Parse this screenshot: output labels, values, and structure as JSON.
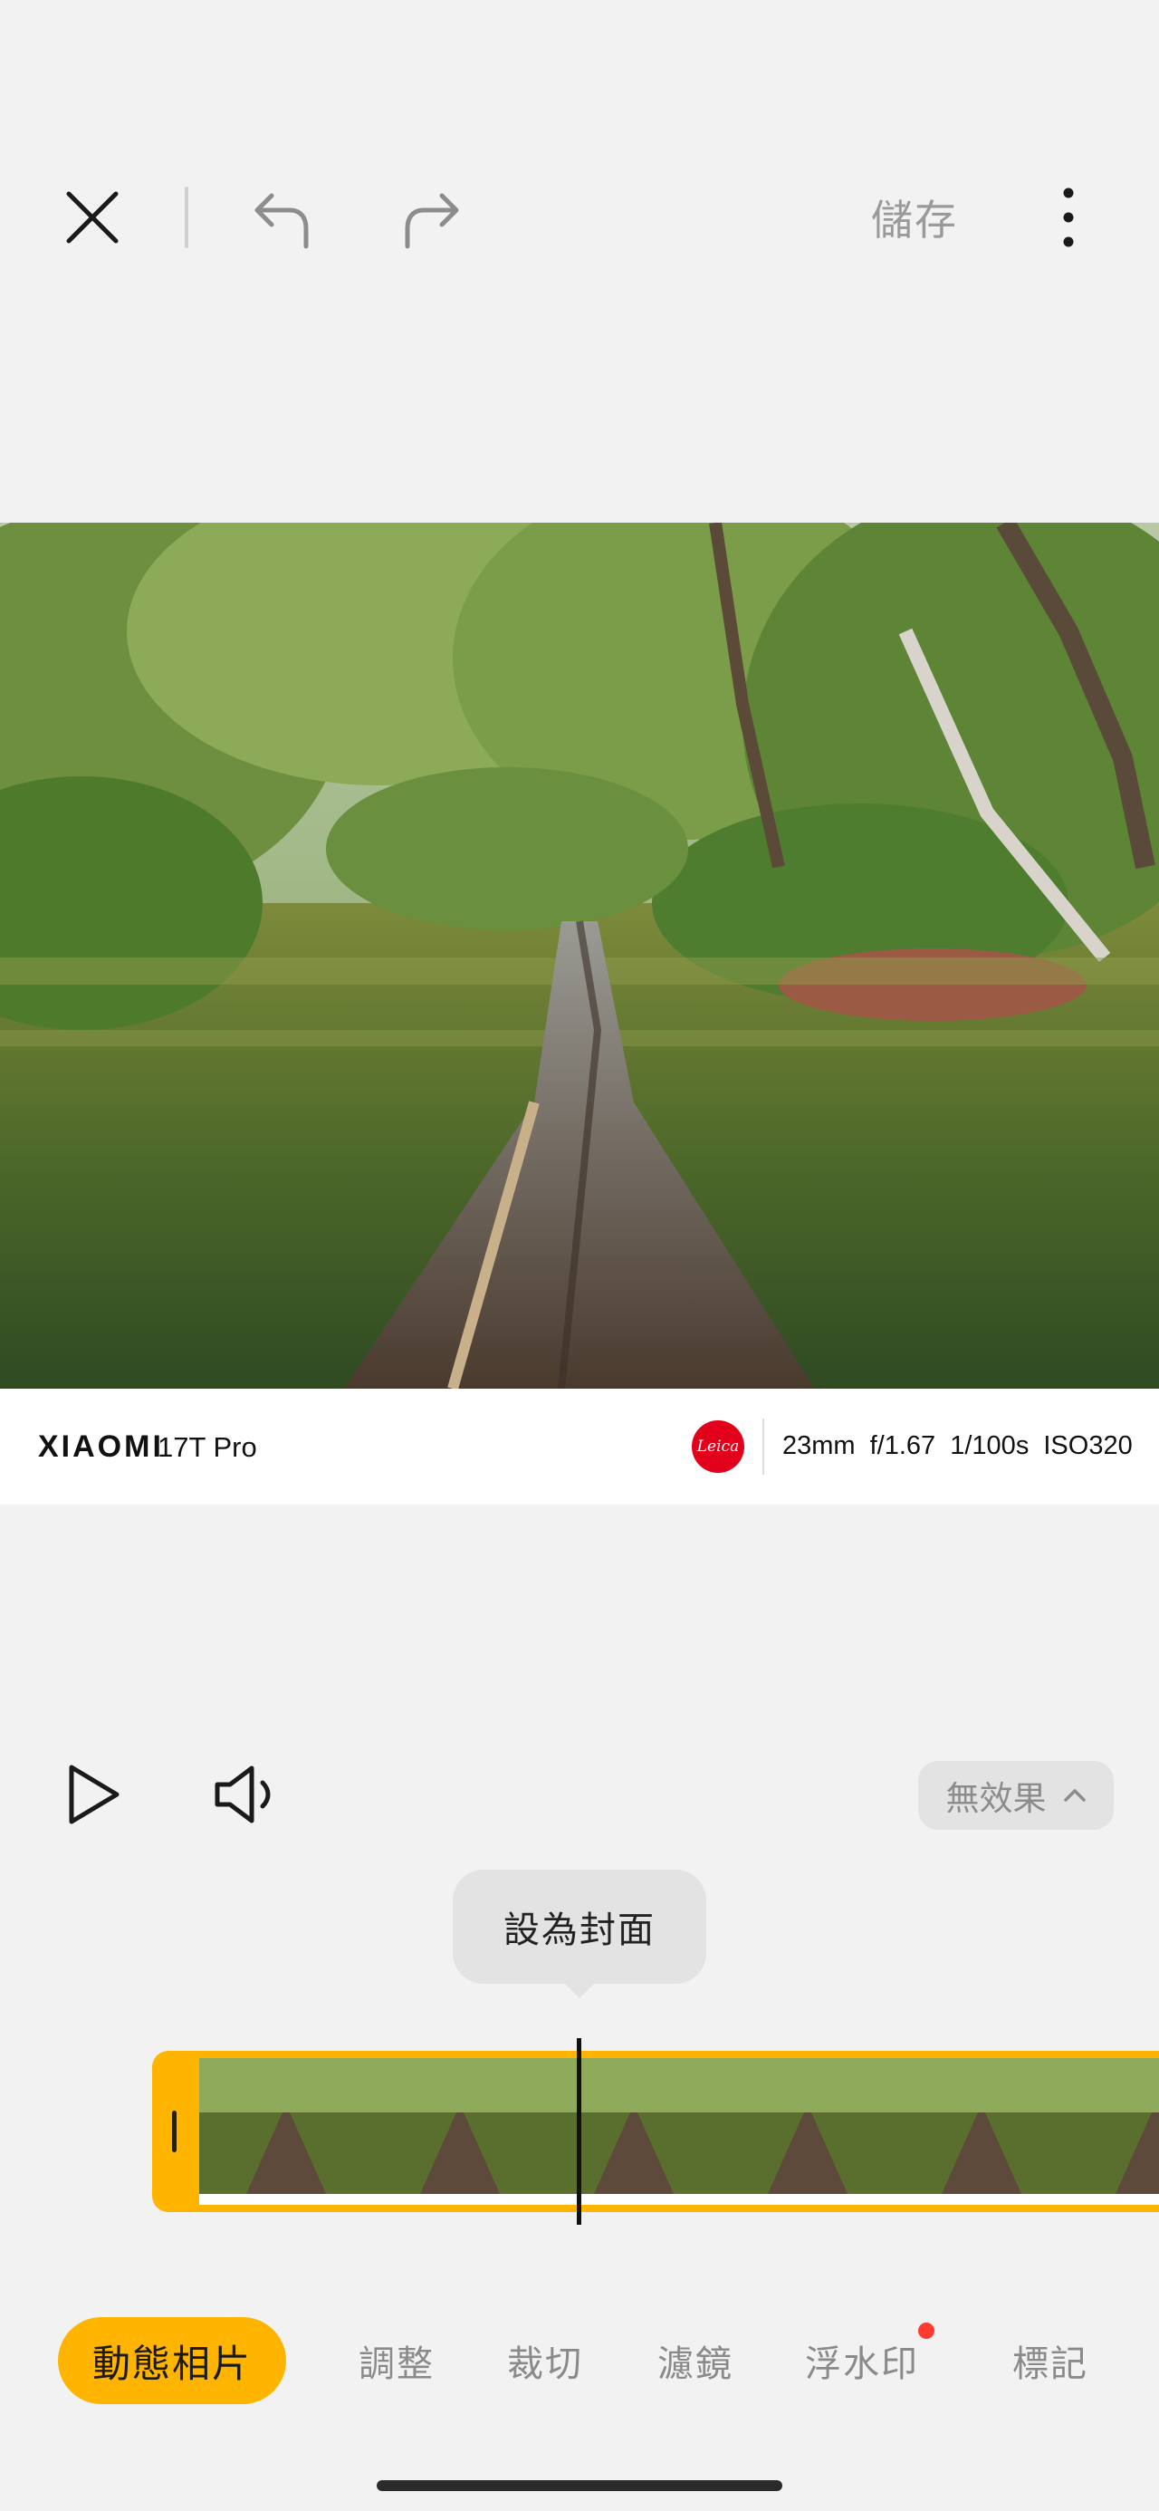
{
  "toolbar": {
    "save_label": "儲存",
    "icons": [
      "close-icon",
      "undo-icon",
      "redo-icon",
      "more-vertical-icon"
    ]
  },
  "watermark": {
    "brand": "XIAOMI",
    "model": "17T Pro",
    "lens_brand_logo": "Leica",
    "params": "23mm  f/1.67  1/100s  ISO320",
    "logo_color": "#e2001a"
  },
  "playback": {
    "icons": [
      "play-icon",
      "volume-icon",
      "chevron-up-icon"
    ],
    "effect_label": "無效果"
  },
  "cover": {
    "tooltip": "設為封面"
  },
  "timeline": {
    "frame_count": 6,
    "accent": "#ffb400"
  },
  "tabs": {
    "live_photo": "動態相片",
    "adjust": "調整",
    "crop": "裁切",
    "filter": "濾鏡",
    "watermark": "浮水印",
    "markup": "標記"
  },
  "colors": {
    "accent": "#ffb400",
    "background": "#f2f2f2",
    "notification_dot": "#ff3b30"
  }
}
